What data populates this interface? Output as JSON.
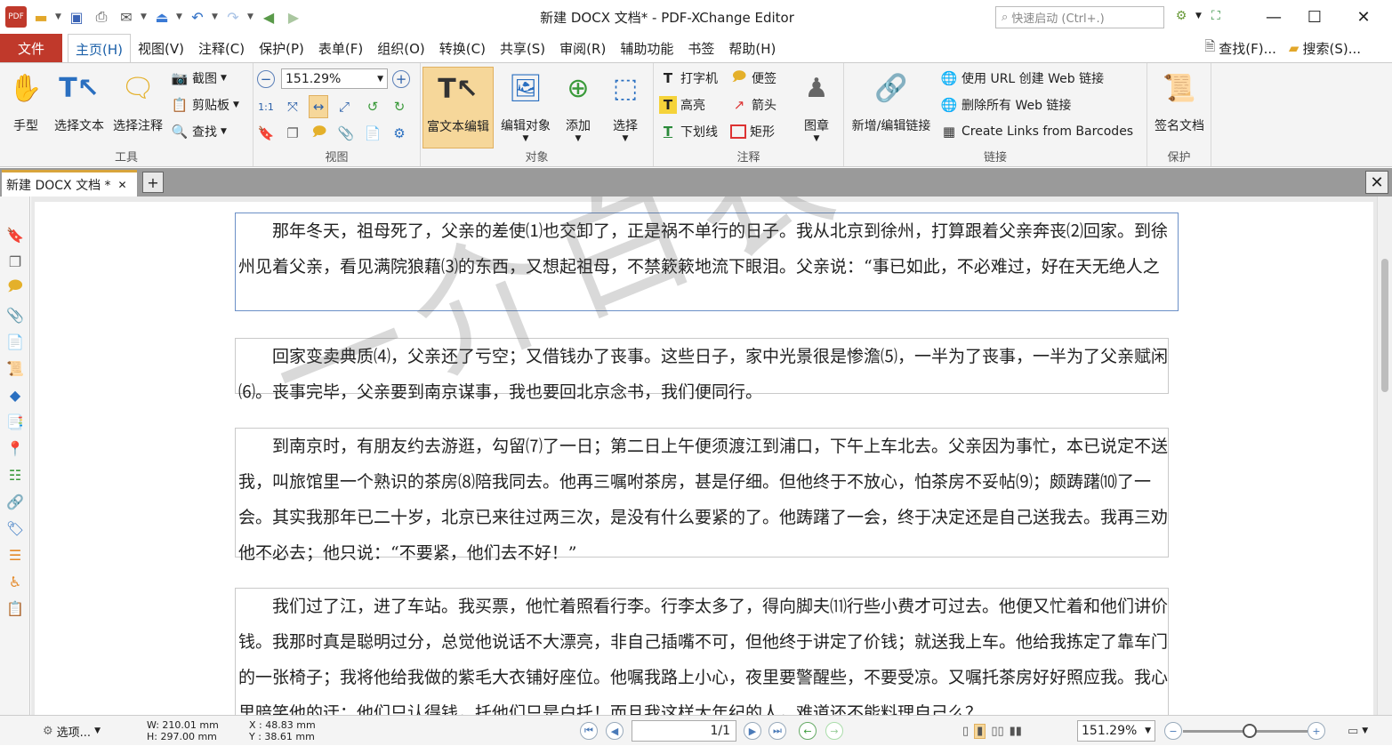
{
  "window": {
    "title": "新建 DOCX 文档* - PDF-XChange Editor",
    "quick_launch_placeholder": "快速启动 (Ctrl+.)",
    "minimize": "—",
    "maximize": "☐",
    "close": "✕"
  },
  "menubar": {
    "file": "文件",
    "items": [
      "主页(H)",
      "视图(V)",
      "注释(C)",
      "保护(P)",
      "表单(F)",
      "组织(O)",
      "转换(C)",
      "共享(S)",
      "审阅(R)",
      "辅助功能",
      "书签",
      "帮助(H)"
    ],
    "active_index": 0,
    "find": "查找(F)...",
    "search": "搜索(S)..."
  },
  "ribbon": {
    "tools": {
      "label": "工具",
      "hand": "手型",
      "select_text": "选择文本",
      "select_comment": "选择注释",
      "snapshot": "截图",
      "clipboard": "剪贴板",
      "find": "查找"
    },
    "view": {
      "label": "视图",
      "zoom_value": "151.29%"
    },
    "objects": {
      "label": "对象",
      "rich_text": "富文本编辑",
      "edit_object": "编辑对象",
      "add": "添加",
      "select": "选择"
    },
    "comment": {
      "label": "注释",
      "typewriter": "打字机",
      "note": "便签",
      "highlight": "高亮",
      "arrow": "箭头",
      "underline": "下划线",
      "rectangle": "矩形",
      "stamp": "图章"
    },
    "links": {
      "label": "链接",
      "new_edit": "新增/编辑链接",
      "create_web_links": "使用 URL 创建 Web 链接",
      "remove_web_links": "删除所有 Web 链接",
      "barcodes": "Create Links from Barcodes"
    },
    "protect": {
      "label": "保护",
      "sign": "签名文档"
    }
  },
  "tab": {
    "name": "新建 DOCX 文档 *",
    "close": "✕",
    "new": "+"
  },
  "document": {
    "paragraphs": [
      "　　那年冬天，祖母死了，父亲的差使⑴也交卸了，正是祸不单行的日子。我从北京到徐州，打算跟着父亲奔丧⑵回家。到徐州见着父亲，看见满院狼藉⑶的东西，又想起祖母，不禁簌簌地流下眼泪。父亲说：“事已如此，不必难过，好在天无绝人之",
      "　　回家变卖典质⑷，父亲还了亏空；又借钱办了丧事。这些日子，家中光景很是惨澹⑸，一半为了丧事，一半为了父亲赋闲⑹。丧事完毕，父亲要到南京谋事，我也要回北京念书，我们便同行。",
      "　　到南京时，有朋友约去游逛，勾留⑺了一日；第二日上午便须渡江到浦口，下午上车北去。父亲因为事忙，本已说定不送我，叫旅馆里一个熟识的茶房⑻陪我同去。他再三嘱咐茶房，甚是仔细。但他终于不放心，怕茶房不妥帖⑼；颇踌躇⑽了一会。其实我那年已二十岁，北京已来往过两三次，是没有什么要紧的了。他踌躇了一会，终于决定还是自己送我去。我再三劝他不必去；他只说：“不要紧，他们去不好！”",
      "　　我们过了江，进了车站。我买票，他忙着照看行李。行李太多了，得向脚夫⑾行些小费才可过去。他便又忙着和他们讲价钱。我那时真是聪明过分，总觉他说话不大漂亮，非自己插嘴不可，但他终于讲定了价钱；就送我上车。他给我拣定了靠车门的一张椅子；我将他给我做的紫毛大衣铺好座位。他嘱我路上小心，夜里要警醒些，不要受凉。又嘱托茶房好好照应我。我心里暗笑他的迂；他们只认得钱，托他们只是白托！而且我这样大年纪的人，难道还不能料理自己么？"
    ],
    "watermark": "一介白衣书阁"
  },
  "statusbar": {
    "options": "选项...",
    "width": "W: 210.01 mm",
    "height": "H: 297.00 mm",
    "x": "X : 48.83 mm",
    "y": "Y : 38.61 mm",
    "page": "1/1",
    "zoom": "151.29%"
  }
}
